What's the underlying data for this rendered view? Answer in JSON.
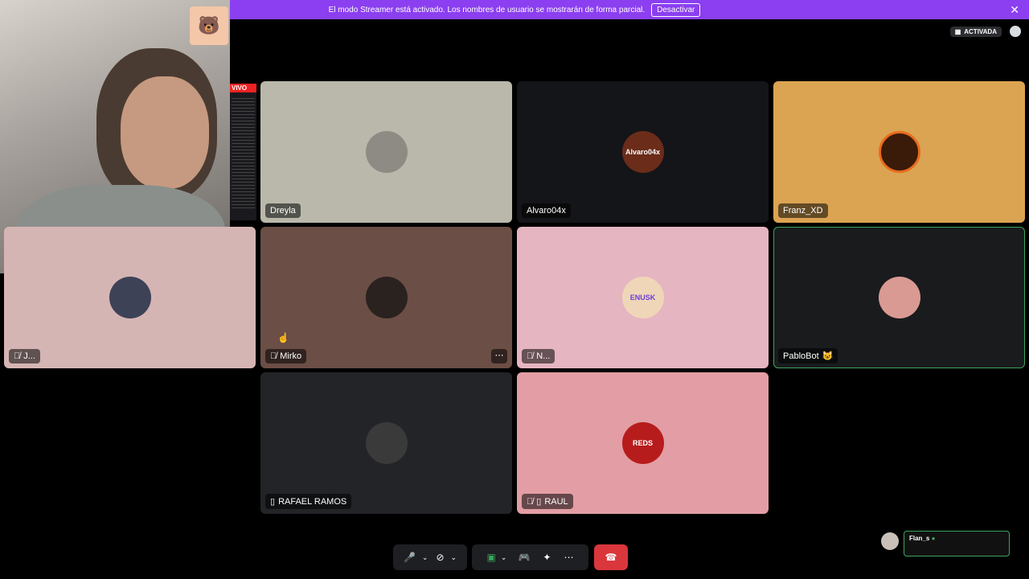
{
  "banner": {
    "message": "El modo Streamer está activado. Los nombres de usuario se mostrarán de forma parcial.",
    "button": "Desactivar"
  },
  "top_right": {
    "badge": "ACTIVADA"
  },
  "live_tag": "VIVO",
  "participants": [
    {
      "name": "Dreyla",
      "bg": "#b9b8aa"
    },
    {
      "name": "Alvaro04x",
      "bg": "#141518",
      "avatar_text": "Alvaro04x"
    },
    {
      "name": "Franz_XD",
      "bg": "#dba452"
    },
    {
      "name": "J...",
      "bg": "#d5b5b3"
    },
    {
      "name": "Mirko",
      "bg": "#6b4e45"
    },
    {
      "name": "N...",
      "bg": "#e5b5c1",
      "avatar_text": "ENUSK"
    },
    {
      "name": "PabloBot",
      "bg": "#1a1b1d",
      "emoji": "😺"
    },
    {
      "name": "RAFAEL RAMOS",
      "bg": "#232428"
    },
    {
      "name": "RAUL",
      "bg": "#e29ea4",
      "avatar_text": "REDS"
    }
  ],
  "self": {
    "name": "Flan_s"
  },
  "icon_names": [
    "mute-icon",
    "chevron-down-icon",
    "camera-off-icon",
    "screen-share-icon",
    "gamepad-icon",
    "soundboard-icon",
    "more-icon",
    "hang-up-icon",
    "mobile-icon",
    "close-icon"
  ],
  "colors": {
    "banner": "#8b3ff0",
    "speaking": "#3ba55d",
    "end_call": "#da373c"
  }
}
